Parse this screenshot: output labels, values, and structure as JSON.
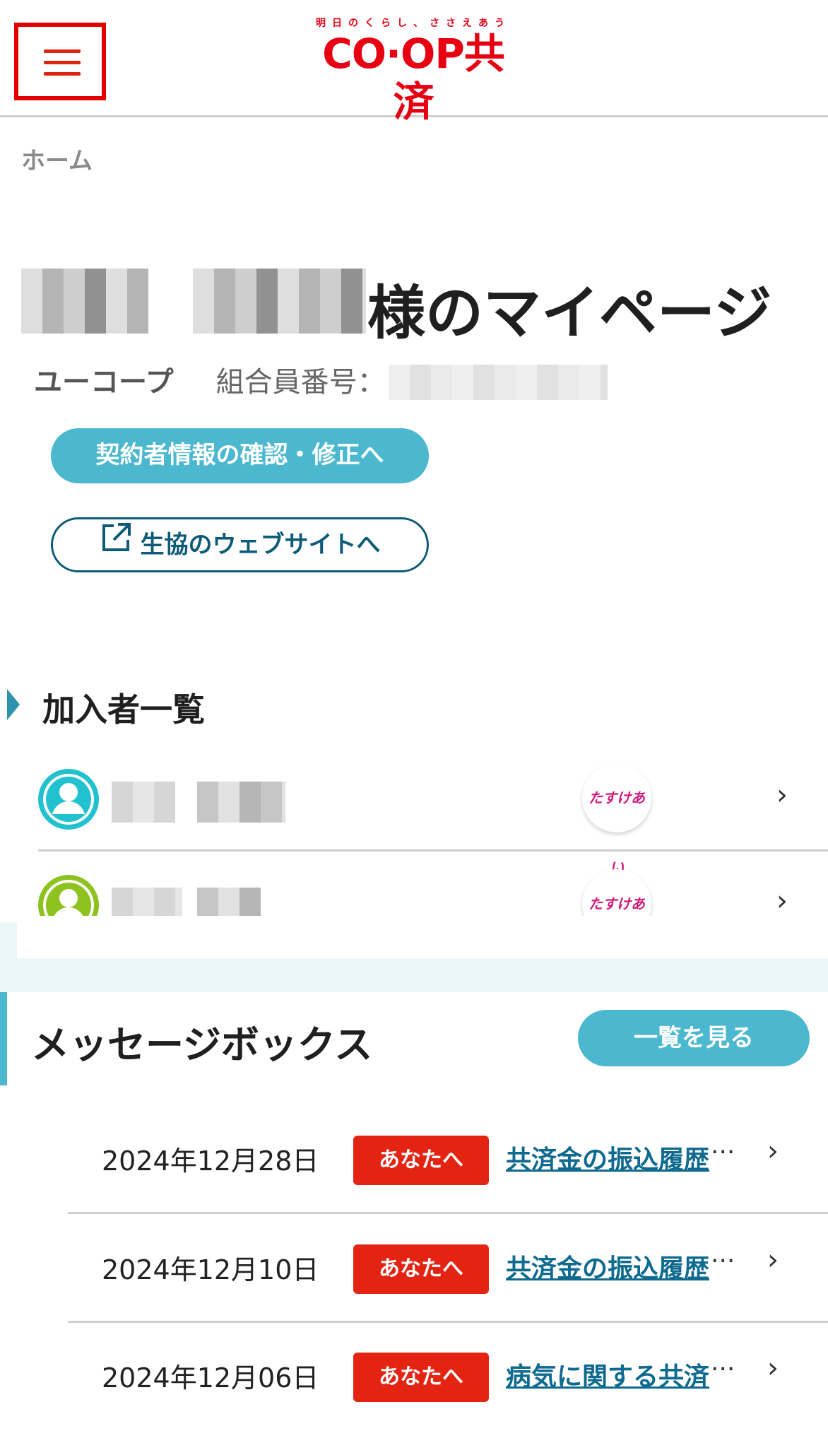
{
  "header": {
    "logo_tagline": "明日のくらし、ささえあう",
    "logo_text": "CO·OP共済"
  },
  "breadcrumb": "ホーム",
  "profile": {
    "title_suffix": "様のマイページ",
    "coop_name": "ユーコープ",
    "member_number_label": "組合員番号："
  },
  "buttons": {
    "contractor_info": "契約者情報の確認・修正へ",
    "coop_website": "生協のウェブサイトへ"
  },
  "members_section": {
    "title": "加入者一覧",
    "members": [
      {
        "plan_badge": "たすけあい",
        "avatar_color": "#22c1cf"
      },
      {
        "plan_badge": "たすけあい",
        "avatar_color": "#8dc21f"
      }
    ]
  },
  "message_box": {
    "title": "メッセージボックス",
    "view_all": "一覧を見る",
    "ellipsis": "···",
    "messages": [
      {
        "date": "2024年12月28日",
        "badge": "あなたへ",
        "subject": "共済金の振込履歴"
      },
      {
        "date": "2024年12月10日",
        "badge": "あなたへ",
        "subject": "共済金の振込履歴"
      },
      {
        "date": "2024年12月06日",
        "badge": "あなたへ",
        "subject": "病気に関する共済"
      }
    ]
  },
  "colors": {
    "brand_red": "#e60012",
    "accent_teal": "#4bb8cf",
    "badge_red": "#e32412",
    "link_blue": "#0e6a8e"
  }
}
